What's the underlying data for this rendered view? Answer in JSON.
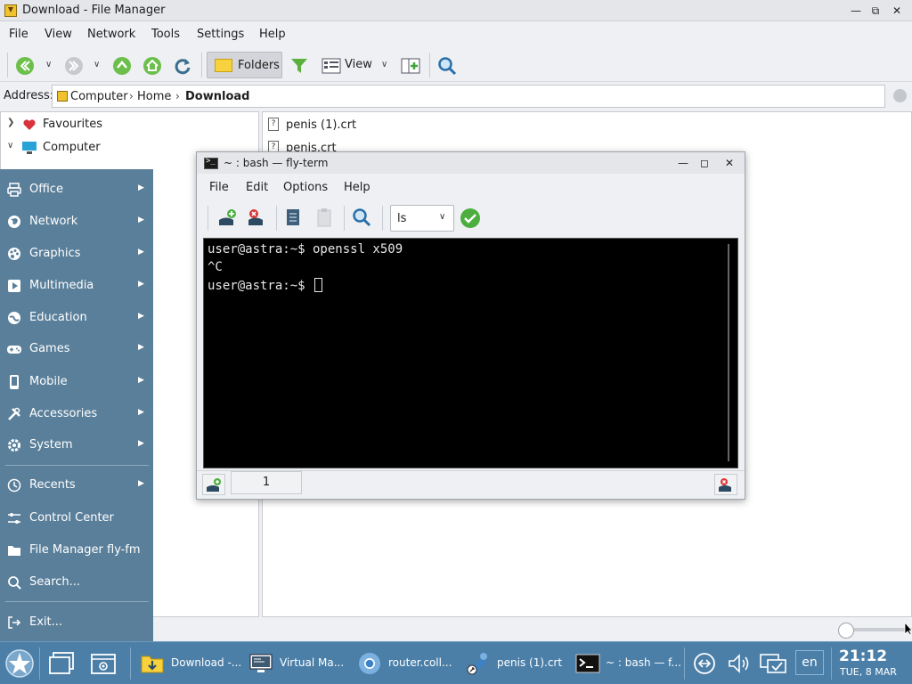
{
  "file_manager": {
    "title": "Download - File Manager",
    "menu": [
      "File",
      "View",
      "Network",
      "Tools",
      "Settings",
      "Help"
    ],
    "toolbar": {
      "folders_label": "Folders",
      "view_label": "View"
    },
    "address": {
      "label": "Address:",
      "crumbs": [
        "Computer",
        "Home",
        "Download"
      ]
    },
    "tree": [
      {
        "label": "Favourites",
        "icon": "heart-icon"
      },
      {
        "label": "Computer",
        "icon": "computer-icon"
      }
    ],
    "files": [
      {
        "name": "penis (1).crt"
      },
      {
        "name": "penis.crt"
      }
    ]
  },
  "start_menu": {
    "items": [
      {
        "label": "Office",
        "icon": "printer-icon",
        "submenu": true
      },
      {
        "label": "Network",
        "icon": "globe-icon",
        "submenu": true
      },
      {
        "label": "Graphics",
        "icon": "palette-icon",
        "submenu": true
      },
      {
        "label": "Multimedia",
        "icon": "play-icon",
        "submenu": true
      },
      {
        "label": "Education",
        "icon": "globe-icon",
        "submenu": true
      },
      {
        "label": "Games",
        "icon": "gamepad-icon",
        "submenu": true
      },
      {
        "label": "Mobile",
        "icon": "phone-icon",
        "submenu": true
      },
      {
        "label": "Accessories",
        "icon": "tools-icon",
        "submenu": true
      },
      {
        "label": "System",
        "icon": "gear-icon",
        "submenu": true
      }
    ],
    "items2": [
      {
        "label": "Recents",
        "icon": "history-icon",
        "submenu": true
      },
      {
        "label": "Control Center",
        "icon": "sliders-icon",
        "submenu": false
      },
      {
        "label": "File Manager fly-fm",
        "icon": "folder-icon",
        "submenu": false
      },
      {
        "label": "Search...",
        "icon": "search-icon",
        "submenu": false
      }
    ],
    "exit_label": "Exit..."
  },
  "terminal": {
    "title": "~ : bash — fly-term",
    "menu": [
      "File",
      "Edit",
      "Options",
      "Help"
    ],
    "command_select": "ls",
    "lines": [
      "user@astra:~$ openssl x509",
      "^C",
      "user@astra:~$ "
    ],
    "tab_number": "1"
  },
  "taskbar": {
    "tasks": [
      {
        "label": "Download -...",
        "icon": "download-folder-icon"
      },
      {
        "label": "Virtual Ma...",
        "icon": "virtual-machine-icon"
      },
      {
        "label": "router.coll...",
        "icon": "chromium-icon"
      },
      {
        "label": "penis (1).crt",
        "icon": "certificate-icon"
      },
      {
        "label": "~ : bash — f...",
        "icon": "terminal-icon"
      }
    ],
    "language": "en",
    "time": "21:12",
    "date": "TUE, 8 MAR"
  }
}
